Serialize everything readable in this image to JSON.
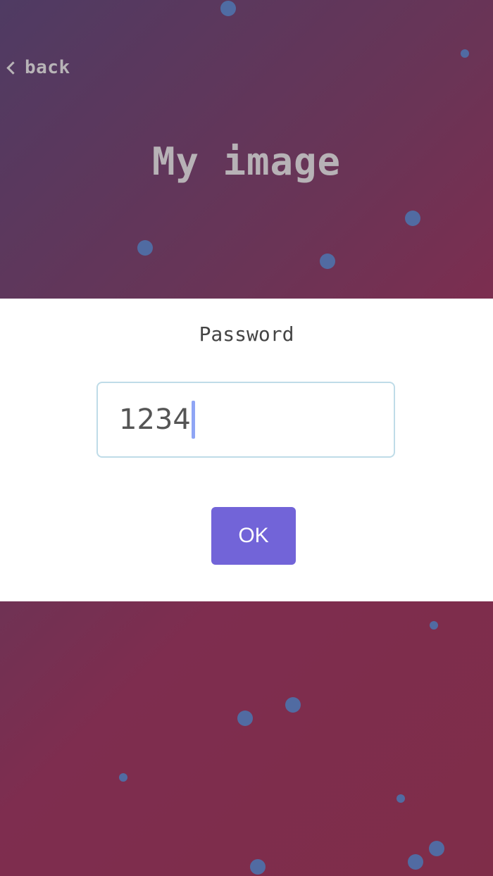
{
  "header": {
    "back_label": "back",
    "title": "My image"
  },
  "dialog": {
    "title": "Password",
    "password_value": "1234",
    "ok_label": "OK"
  },
  "colors": {
    "accent": "#7264d8",
    "bubble": "#4f6fa6",
    "background_top": "#4f3b63",
    "background_bottom": "#7f2d49"
  }
}
